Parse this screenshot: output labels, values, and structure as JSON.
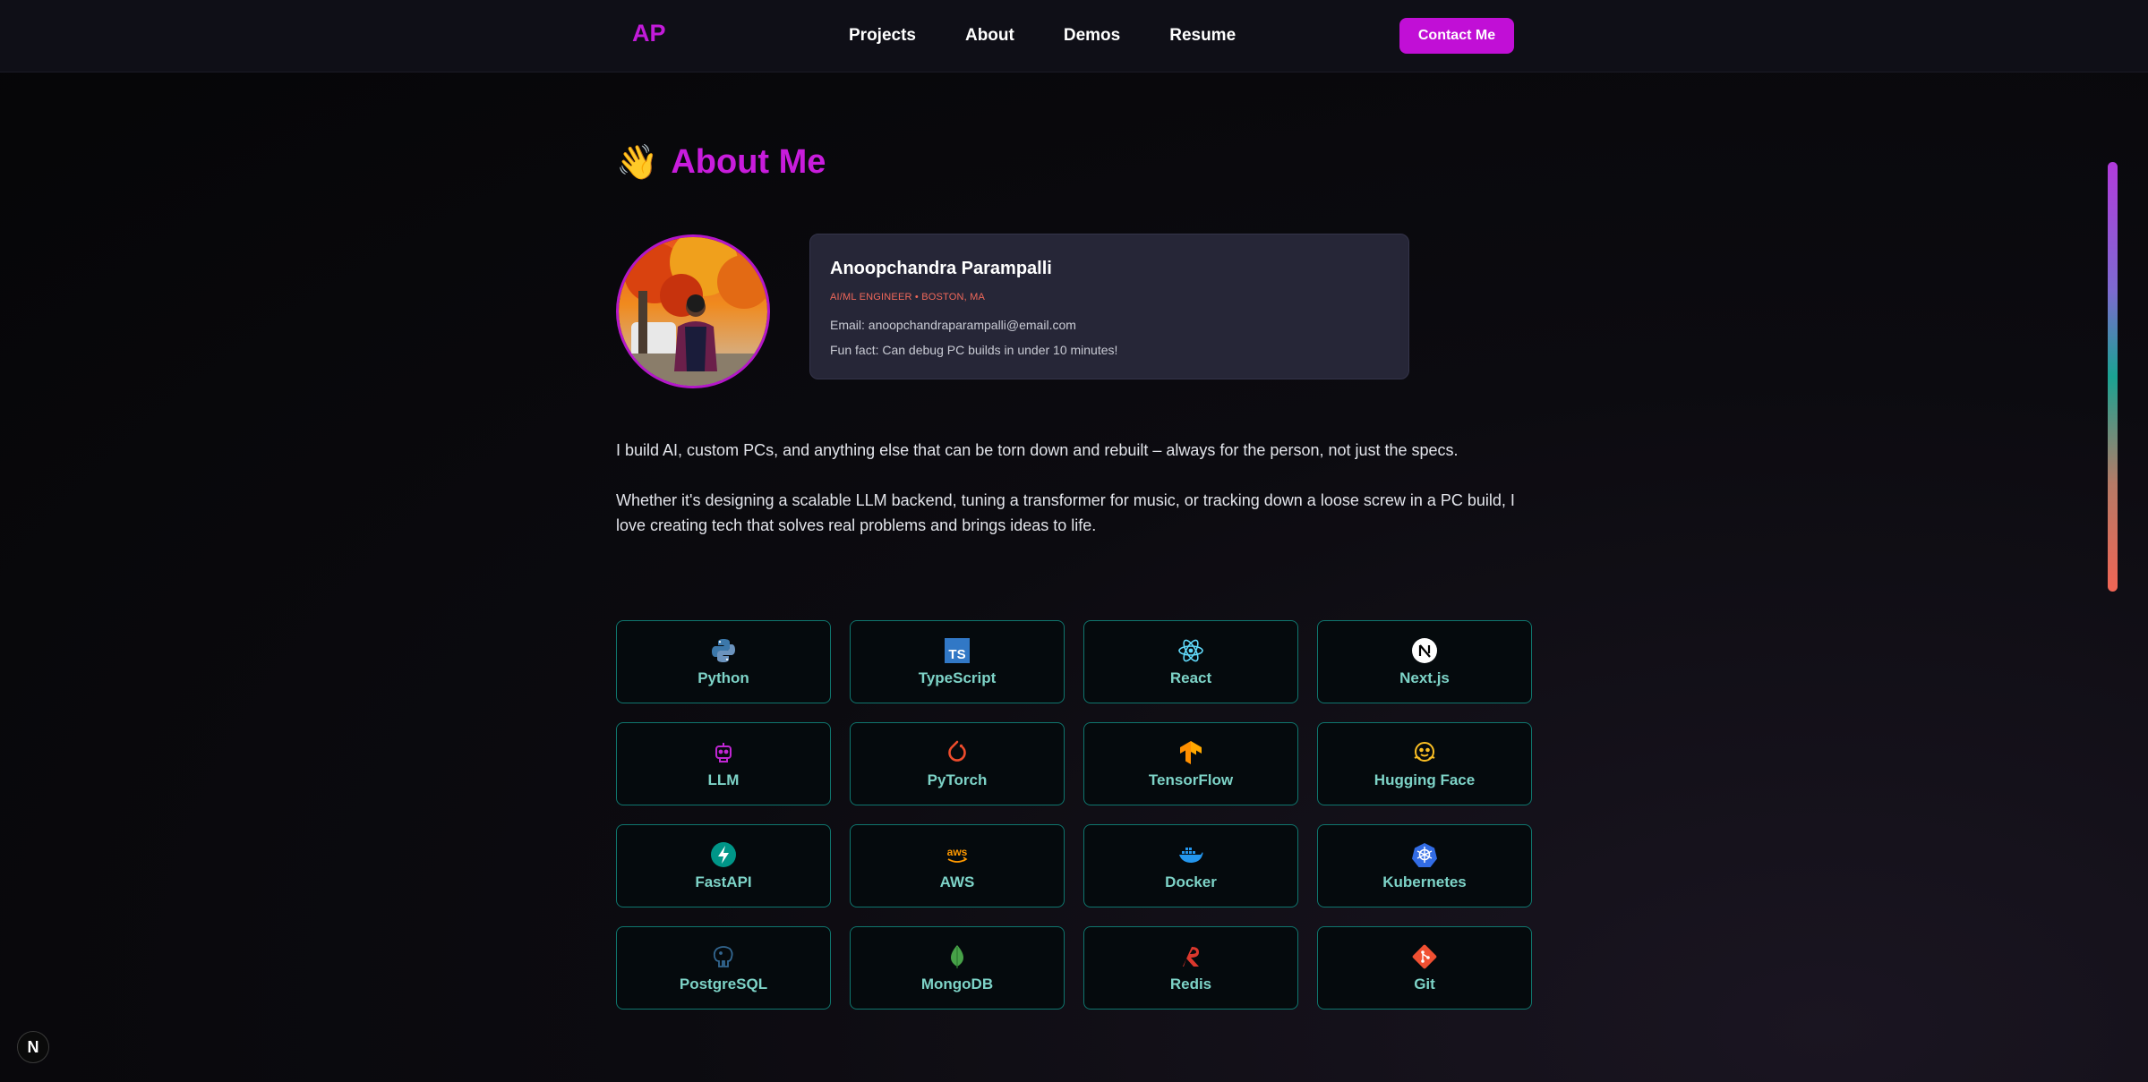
{
  "nav": {
    "logo": "AP",
    "links": [
      "Projects",
      "About",
      "Demos",
      "Resume"
    ],
    "contact_label": "Contact Me",
    "accent_color": "#c10fd6"
  },
  "about": {
    "wave_emoji": "👋",
    "title": "About Me",
    "avatar_icon": "profile-photo"
  },
  "profile": {
    "name": "Anoopchandra Parampalli",
    "role": "AI/ML ENGINEER • BOSTON, MA",
    "email_line": "Email: anoopchandraparampalli@email.com",
    "fun_fact": "Fun fact: Can debug PC builds in under 10 minutes!"
  },
  "bio": [
    "I build AI, custom PCs, and anything else that can be torn down and rebuilt – always for the person, not just the specs.",
    "Whether it's designing a scalable LLM backend, tuning a transformer for music, or tracking down a loose screw in a PC build, I love creating tech that solves real problems and brings ideas to life."
  ],
  "skills": [
    {
      "label": "Python",
      "icon": "python-icon"
    },
    {
      "label": "TypeScript",
      "icon": "typescript-icon"
    },
    {
      "label": "React",
      "icon": "react-icon"
    },
    {
      "label": "Next.js",
      "icon": "nextjs-icon"
    },
    {
      "label": "LLM",
      "icon": "robot-icon"
    },
    {
      "label": "PyTorch",
      "icon": "pytorch-icon"
    },
    {
      "label": "TensorFlow",
      "icon": "tensorflow-icon"
    },
    {
      "label": "Hugging Face",
      "icon": "hugging-face-icon"
    },
    {
      "label": "FastAPI",
      "icon": "fastapi-icon"
    },
    {
      "label": "AWS",
      "icon": "aws-icon"
    },
    {
      "label": "Docker",
      "icon": "docker-icon"
    },
    {
      "label": "Kubernetes",
      "icon": "kubernetes-icon"
    },
    {
      "label": "PostgreSQL",
      "icon": "postgresql-icon"
    },
    {
      "label": "MongoDB",
      "icon": "mongodb-icon"
    },
    {
      "label": "Redis",
      "icon": "redis-icon"
    },
    {
      "label": "Git",
      "icon": "git-icon"
    }
  ],
  "dev_badge": "N"
}
